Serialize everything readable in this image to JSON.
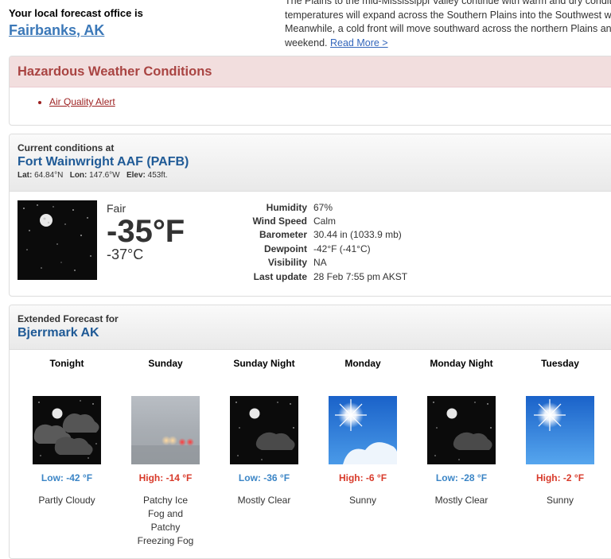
{
  "local_office": {
    "label": "Your local forecast office is",
    "city": "Fairbanks, AK"
  },
  "news": {
    "lines": [
      "The Plains to the mid-Mississippi Valley continue with warm and dry condition",
      "temperatures will expand across the Southern Plains into the Southwest wher",
      "Meanwhile, a cold front will move southward across the northern Plains and G",
      "weekend."
    ],
    "read_more": "Read More >"
  },
  "hazard": {
    "title": "Hazardous Weather Conditions",
    "items": [
      "Air Quality Alert"
    ]
  },
  "current": {
    "label": "Current conditions at",
    "station": "Fort Wainwright AAF (PAFB)",
    "lat_label": "Lat:",
    "lat": "64.84°N",
    "lon_label": "Lon:",
    "lon": "147.6°W",
    "elev_label": "Elev:",
    "elev": "453ft.",
    "summary": "Fair",
    "temp_f": "-35°F",
    "temp_c": "-37°C",
    "details": [
      {
        "k": "Humidity",
        "v": "67%"
      },
      {
        "k": "Wind Speed",
        "v": "Calm"
      },
      {
        "k": "Barometer",
        "v": "30.44 in (1033.9 mb)"
      },
      {
        "k": "Dewpoint",
        "v": "-42°F (-41°C)"
      },
      {
        "k": "Visibility",
        "v": "NA"
      },
      {
        "k": "Last update",
        "v": "28 Feb 7:55 pm AKST"
      }
    ]
  },
  "extended": {
    "label": "Extended Forecast for",
    "location": "Bjerrmark AK",
    "periods": [
      {
        "name": "Tonight",
        "temp": "Low: -42 °F",
        "type": "low",
        "icon": "partly-cloudy-night-icon",
        "desc": "Partly Cloudy"
      },
      {
        "name": "Sunday",
        "temp": "High: -14 °F",
        "type": "high",
        "icon": "fog-icon",
        "desc": "Patchy Ice Fog and Patchy Freezing Fog"
      },
      {
        "name": "Sunday Night",
        "temp": "Low: -36 °F",
        "type": "low",
        "icon": "mostly-clear-night-icon",
        "desc": "Mostly Clear"
      },
      {
        "name": "Monday",
        "temp": "High: -6 °F",
        "type": "high",
        "icon": "sunny-clouds-icon",
        "desc": "Sunny"
      },
      {
        "name": "Monday Night",
        "temp": "Low: -28 °F",
        "type": "low",
        "icon": "mostly-clear-night-icon",
        "desc": "Mostly Clear"
      },
      {
        "name": "Tuesday",
        "temp": "High: -2 °F",
        "type": "high",
        "icon": "sunny-icon",
        "desc": "Sunny"
      }
    ]
  },
  "colors": {
    "link": "#3b78b8",
    "station": "#1f5a96",
    "hazard_bg": "#f2dede",
    "hazard_text": "#a94442",
    "low": "#3b85c6",
    "high": "#d83a2a"
  }
}
